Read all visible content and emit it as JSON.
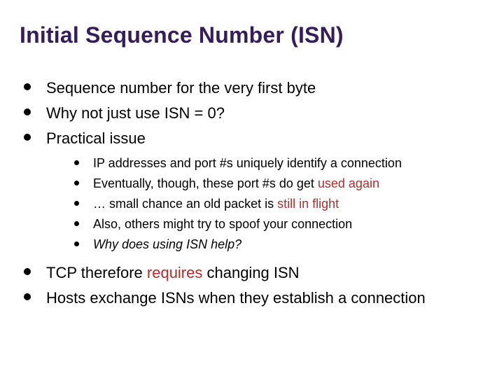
{
  "title": "Initial Sequence Number (ISN)",
  "top": {
    "b1": "Sequence number for the very first byte",
    "b2": "Why not just use ISN = 0?",
    "b3": "Practical issue",
    "b4_a": "TCP therefore ",
    "b4_b": "requires",
    "b4_c": " changing ISN",
    "b5": "Hosts exchange ISNs when they establish a connection"
  },
  "sub": {
    "s1": "IP addresses and port #s uniquely identify a connection",
    "s2_a": "Eventually, though, these port #s do get ",
    "s2_b": "used again",
    "s3_a": "… small chance an old packet is ",
    "s3_b": "still in flight",
    "s4": "Also, others might try to spoof your connection",
    "s5": "Why does using ISN help?"
  }
}
